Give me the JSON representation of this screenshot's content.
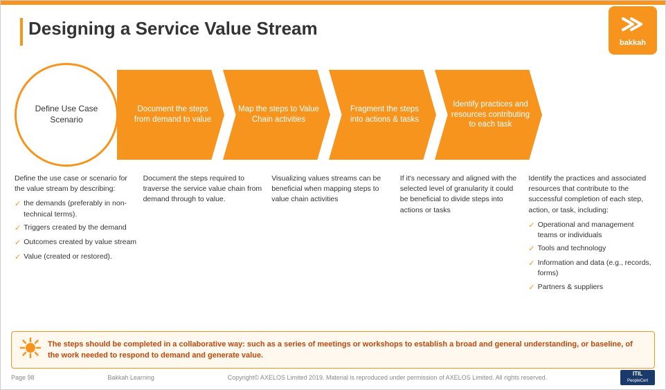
{
  "slide": {
    "title": "Designing a Service Value Stream",
    "page_number": "Page 98",
    "footer_center": "Bakkah Learning",
    "footer_copyright": "Copyright© AXELOS Limited 2019. Material is reproduced under permission of AXELOS Limited. All rights reserved.",
    "logo_text": "bakkah"
  },
  "steps": [
    {
      "id": "step1",
      "label": "Define Use Case Scenario",
      "shape": "circle"
    },
    {
      "id": "step2",
      "label": "Document the steps from demand to value",
      "shape": "arrow"
    },
    {
      "id": "step3",
      "label": "Map the steps to Value Chain activities",
      "shape": "arrow"
    },
    {
      "id": "step4",
      "label": "Fragment the steps into actions & tasks",
      "shape": "arrow"
    },
    {
      "id": "step5",
      "label": "Identify practices and resources contributing to each task",
      "shape": "arrow"
    }
  ],
  "descriptions": [
    {
      "id": "desc1",
      "intro": "Define the use case or scenario for the value stream by describing:",
      "bullets": [
        "the demands (preferably in non-technical terms).",
        "Triggers created by the demand",
        "Outcomes created by value stream",
        "Value (created or restored)."
      ]
    },
    {
      "id": "desc2",
      "intro": "Document the steps required to traverse the service value chain from demand through to value.",
      "bullets": []
    },
    {
      "id": "desc3",
      "intro": "Visualizing values streams can be beneficial when mapping steps to value chain activities",
      "bullets": []
    },
    {
      "id": "desc4",
      "intro": "If it's necessary and aligned with the selected level of granularity it could be beneficial to divide steps into actions or tasks",
      "bullets": []
    },
    {
      "id": "desc5",
      "intro": "Identify the practices and associated resources that contribute to the successful completion of each step, action, or task, including:",
      "bullets": [
        "Operational and management teams or individuals",
        "Tools and technology",
        "Information and data (e.g., records, forms)",
        "Partners & suppliers"
      ]
    }
  ],
  "banner": {
    "text": "The steps should be completed in a collaborative way:  such as a series of meetings or workshops to establish a broad and general understanding, or baseline, of the work needed to respond to demand and generate value."
  },
  "icons": {
    "check": "✓",
    "sun": "✦",
    "bakkah_icon": "⟳"
  }
}
